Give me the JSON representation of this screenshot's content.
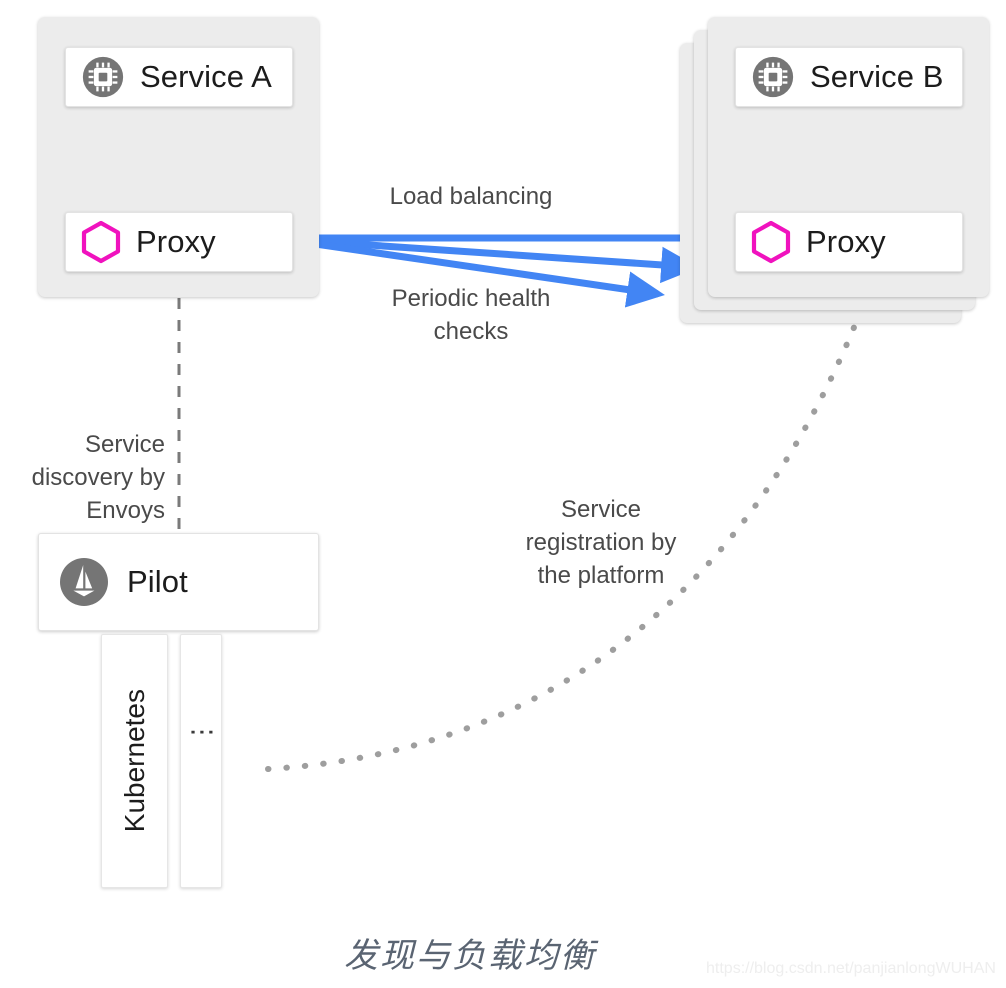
{
  "diagram": {
    "caption": "发现与负载均衡",
    "watermark": "https://blog.csdn.net/panjianlongWUHAN",
    "colors": {
      "arrow_blue": "#4285F4",
      "proxy_magenta": "#F012BE",
      "icon_gray": "#757575",
      "group_bg": "#ECECEC",
      "card_bg": "#FFFFFF",
      "text_dark": "#1C1C1C",
      "annotation_gray": "#4A4A4A",
      "dotted_gray": "#9E9E9E",
      "caption_gray": "#5A6472"
    }
  },
  "group_a": {
    "service": {
      "label": "Service A",
      "icon": "cpu-chip-icon"
    },
    "proxy": {
      "label": "Proxy",
      "icon": "hexagon-icon"
    }
  },
  "group_b": {
    "stack_count": 3,
    "service": {
      "label": "Service B",
      "icon": "cpu-chip-icon"
    },
    "proxy": {
      "label": "Proxy",
      "icon": "hexagon-icon"
    }
  },
  "pilot": {
    "label": "Pilot",
    "icon": "istio-sail-icon"
  },
  "platforms": [
    {
      "label": "Kubernetes",
      "kind": "text"
    },
    {
      "label": "⋮",
      "kind": "ellipsis"
    }
  ],
  "annotations": {
    "load_balancing": "Load balancing",
    "periodic_health_checks": "Periodic health\nchecks",
    "service_discovery": "Service\ndiscovery by\nEnvoys",
    "service_registration": "Service\nregistration by\nthe platform"
  },
  "connections": {
    "service_a_proxy_a": "bidirectional-arrow",
    "service_b_proxy_b": "bidirectional-arrow",
    "proxy_a_to_proxy_b": "load-balancing-arrows",
    "pilot_to_proxy_a": "dashed-line",
    "platform_to_service_b": "dotted-curve"
  }
}
